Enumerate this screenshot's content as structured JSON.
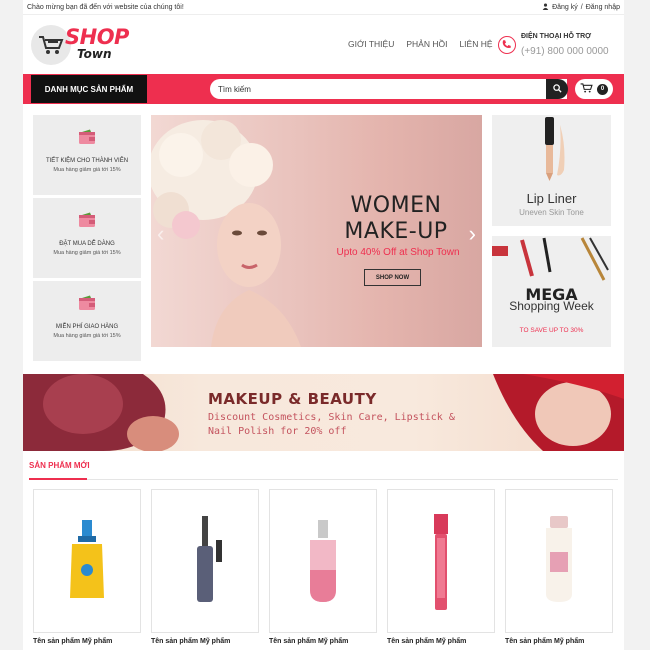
{
  "topbar": {
    "welcome": "Chào mừng bạn đã đến với website của chúng tôi!",
    "register": "Đăng ký",
    "separator": "/",
    "login": "Đăng nhập"
  },
  "logo": {
    "shop": "SHOP",
    "town": "Town"
  },
  "nav": {
    "items": [
      "GIỚI THIỆU",
      "PHẢN HỒI",
      "LIÊN HỆ"
    ]
  },
  "hotline": {
    "label": "ĐIỆN THOẠI HỖ TRỢ",
    "number": "(+91) 800 000 0000"
  },
  "toolbar": {
    "category_label": "DANH MỤC SẢN PHẨM",
    "search_placeholder": "Tìm kiếm",
    "cart_count": "0"
  },
  "perks": [
    {
      "title": "TIẾT KIỆM CHO THÀNH VIÊN",
      "sub": "Mua hàng giảm giá tới 15%"
    },
    {
      "title": "ĐẶT MUA DỄ DÀNG",
      "sub": "Mua hàng giảm giá tới 15%"
    },
    {
      "title": "MIỄN PHÍ GIAO HÀNG",
      "sub": "Mua hàng giảm giá tới 15%"
    }
  ],
  "hero": {
    "title_line1": "WOMEN",
    "title_line2": "MAKE-UP",
    "subtitle": "Upto 40% Off at Shop Town",
    "button": "SHOP NOW"
  },
  "promo1": {
    "title": "Lip Liner",
    "sub": "Uneven Skin Tone"
  },
  "promo2": {
    "title": "MEGA",
    "sub": "Shopping Week",
    "tag": "TO SAVE UP TO 30%"
  },
  "banner": {
    "title": "MAKEUP & BEAUTY",
    "sub": "Discount Cosmetics, Skin Care, Lipstick & Nail Polish for 20% off"
  },
  "new_products": {
    "title": "SẢN PHẨM MỚI",
    "items": [
      {
        "name": "Tên sản phẩm Mỹ phẩm"
      },
      {
        "name": "Tên sản phẩm Mỹ phẩm"
      },
      {
        "name": "Tên sản phẩm Mỹ phẩm"
      },
      {
        "name": "Tên sản phẩm Mỹ phẩm"
      },
      {
        "name": "Tên sản phẩm Mỹ phẩm"
      }
    ]
  },
  "colors": {
    "accent": "#ee2f4f",
    "dark": "#111111",
    "panel": "#ededed"
  },
  "icons": {
    "cart": "cart-icon",
    "user": "user-icon",
    "phone": "phone-icon",
    "wallet": "wallet-icon",
    "search": "search-icon"
  }
}
